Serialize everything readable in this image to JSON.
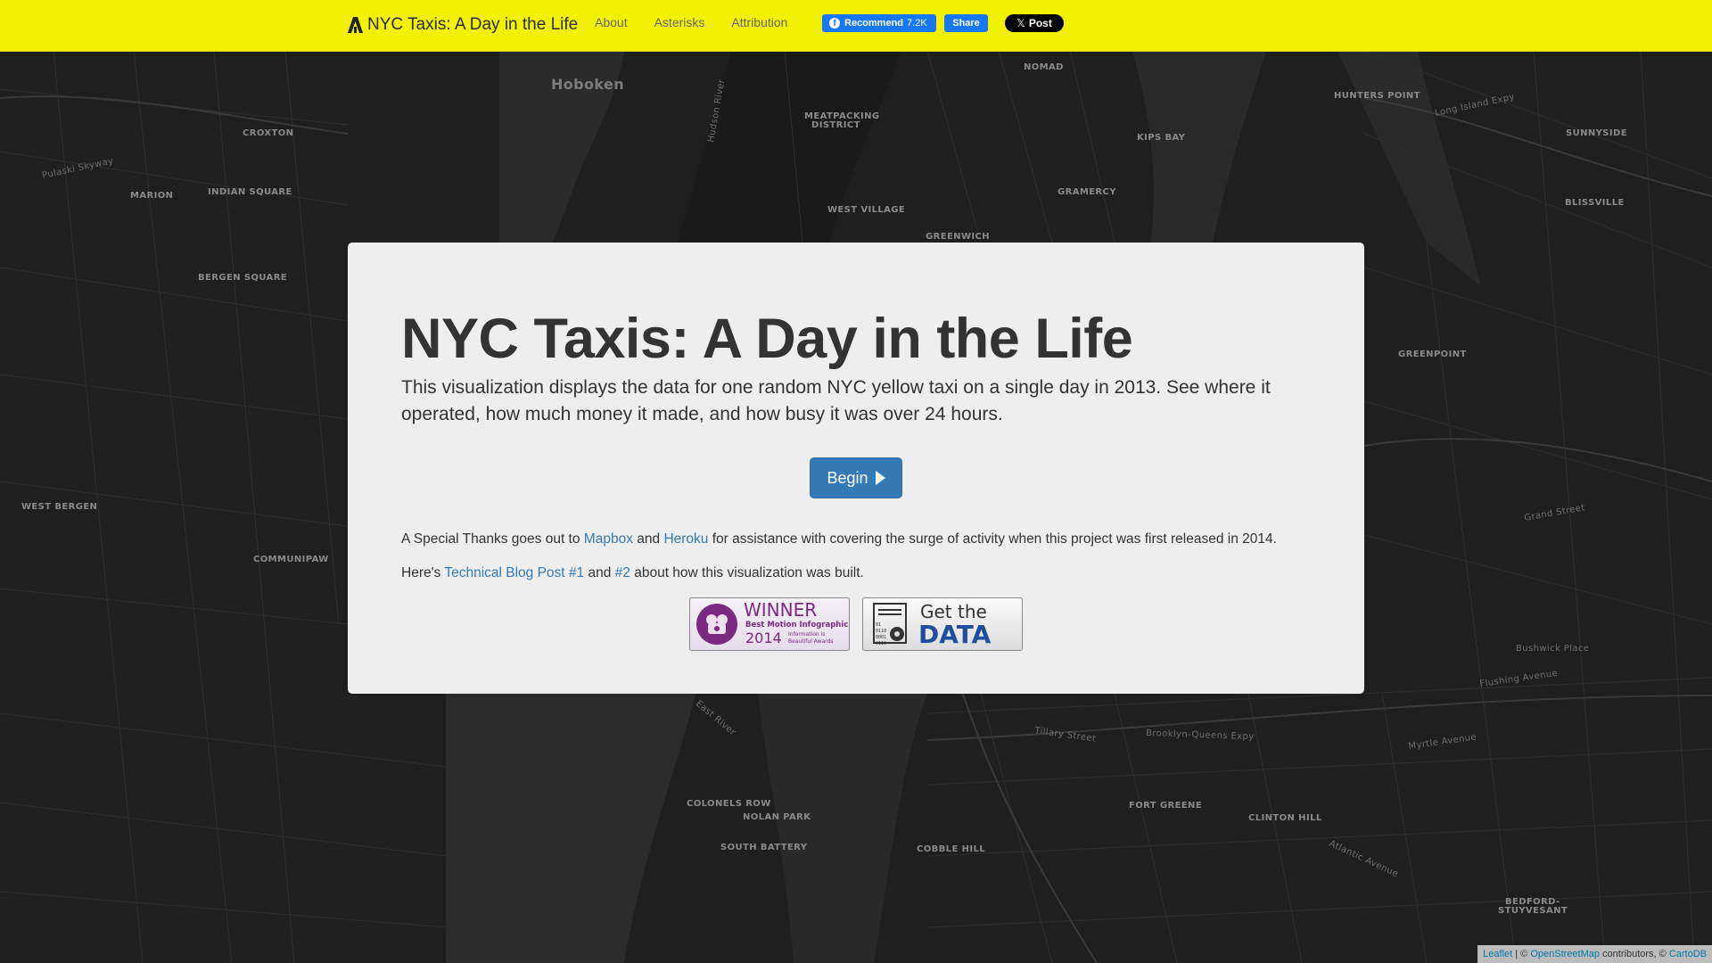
{
  "nav": {
    "brand": "NYC Taxis: A Day in the Life",
    "links": [
      "About",
      "Asterisks",
      "Attribution"
    ],
    "fb_recommend": "Recommend",
    "fb_count": "7.2K",
    "fb_share": "Share",
    "x_post": "Post"
  },
  "panel": {
    "title": "NYC Taxis: A Day in the Life",
    "lead": "This visualization displays the data for one random NYC yellow taxi on a single day in 2013. See where it operated, how much money it made, and how busy it was over 24 hours.",
    "begin": "Begin",
    "thanks_pre": "A Special Thanks goes out to ",
    "mapbox": "Mapbox",
    "and": " and ",
    "heroku": "Heroku",
    "thanks_post": " for assistance with covering the surge of activity when this project was first released in 2014.",
    "blog_pre": "Here's ",
    "blog1": "Technical Blog Post #1",
    "blog_and": " and ",
    "blog2": "#2",
    "blog_post": " about how this visualization was built."
  },
  "badges": {
    "winner_title": "WINNER",
    "winner_sub": "Best Motion Infographic",
    "winner_year": "2014",
    "winner_org1": "Information is",
    "winner_org2": "Beautiful Awards",
    "data_line1": "Get the",
    "data_line2": "DATA",
    "data_bits": [
      "01",
      "0110",
      "0001",
      "0110"
    ]
  },
  "map": {
    "labels": [
      "Hoboken",
      "NOMAD",
      "HUNTERS POINT",
      "MEATPACKING",
      "DISTRICT",
      "KIPS BAY",
      "SUNNYSIDE",
      "CROXTON",
      "MARION",
      "INDIAN SQUARE",
      "GRAMERCY",
      "BLISSVILLE",
      "WEST VILLAGE",
      "GREENWICH",
      "BERGEN SQUARE",
      "GREENPOINT",
      "WEST BERGEN",
      "COMMUNIPAW",
      "COLONELS ROW",
      "NOLAN PARK",
      "SOUTH BATTERY",
      "COBBLE HILL",
      "FORT GREENE",
      "CLINTON HILL",
      "BEDFORD-",
      "STUYVESANT"
    ],
    "streets": [
      "Long Island Expy",
      "Pulaski Skyway",
      "Grand Street",
      "Flushing Avenue",
      "Myrtle Avenue",
      "Atlantic Avenue",
      "Brooklyn-Queens Expy",
      "Tillary Street",
      "Bushwick Place",
      "Hudson River",
      "East River"
    ]
  },
  "attribution": {
    "leaflet": "Leaflet",
    "sep": " | © ",
    "osm": "OpenStreetMap",
    "contrib": " contributors, © ",
    "carto": "CartoDB"
  },
  "colors": {
    "navbar": "#f2f200",
    "accent": "#337ab7",
    "panel": "#eeeeee",
    "map_bg": "#1e1e1e"
  }
}
